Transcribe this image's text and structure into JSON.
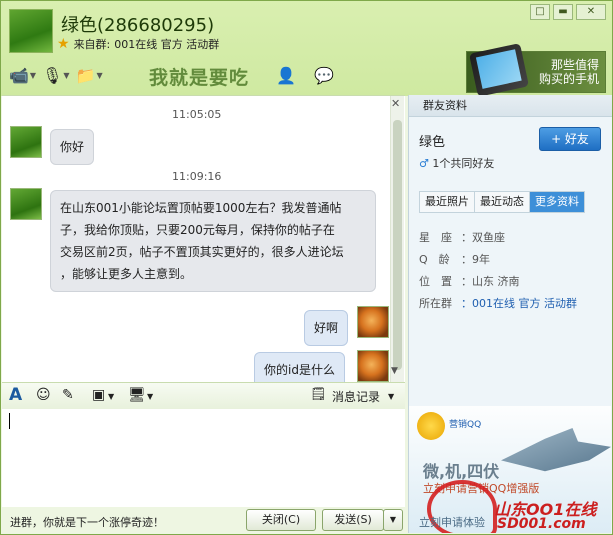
{
  "window": {
    "title": "绿色(286680295)",
    "from_label": "来自群:",
    "from_group": "001在线 官方 活动群",
    "controls": [
      "□",
      "▬",
      "✕"
    ]
  },
  "banner": {
    "art_text": "我就是要吃",
    "ad_text_line1": "那些值得",
    "ad_text_line2": "购买的手机"
  },
  "messages": [
    {
      "time": "11:05:05"
    },
    {
      "text": "你好",
      "side": "left"
    },
    {
      "time": "11:09:16"
    },
    {
      "lines": [
        "在山东001小能论坛置顶帖要1000左右？我发普通帖",
        "子，我给你顶贴，只要200元每月，保持你的帖子在",
        "交易区前2页，帖子不置顶其实更好的，很多人进论坛",
        "，能够让更多人主意到。"
      ],
      "side": "left"
    },
    {
      "text": "好啊",
      "side": "right"
    },
    {
      "text": "你的id是什么",
      "side": "right"
    }
  ],
  "input_toolbar": {
    "history_label": "消息记录"
  },
  "bottom": {
    "tip": "进群，你就是下一个涨停奇迹！",
    "close_label": "关闭(C)",
    "send_label": "发送(S)"
  },
  "profile": {
    "header": "群友资料",
    "name": "绿色",
    "add_friend": "+ 好友",
    "common_friends": "1个共同好友",
    "tabs": [
      "最近照片",
      "最近动态",
      "更多资料"
    ],
    "active_tab": 2,
    "fields": [
      {
        "label": "星　座",
        "value": "：双鱼座"
      },
      {
        "label": "Q　龄",
        "value": "：9年"
      },
      {
        "label": "位　置",
        "value": "：山东 济南"
      },
      {
        "label": "所在群",
        "value": "：001在线 官方 活动群"
      }
    ]
  },
  "ad_bottom": {
    "brand": "营销QQ",
    "line1": "微,机,四伏",
    "line2": "立刻申请营销QQ增强版",
    "small": "立刻申请体验"
  },
  "watermark": {
    "line1": "山东OO1在线",
    "line2": "SD001.com"
  },
  "colors": {
    "accent_blue": "#3d8fd8",
    "title_green": "#1e3a08",
    "watermark_red": "#cc1f1f"
  }
}
